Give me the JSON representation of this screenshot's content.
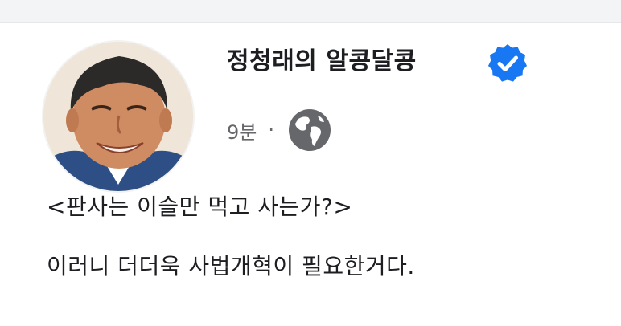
{
  "post": {
    "author_name": "정청래의 알콩달콩",
    "verified_icon": "verified-badge-icon",
    "time": "9분",
    "separator": "·",
    "audience_icon": "globe-icon",
    "lines": [
      "<판사는 이슬만 먹고 사는가?>",
      "이러니 더더욱 사법개혁이 필요한거다."
    ]
  },
  "colors": {
    "verified_blue": "#1877f2",
    "meta_gray": "#65676b",
    "text": "#1c1e21"
  }
}
